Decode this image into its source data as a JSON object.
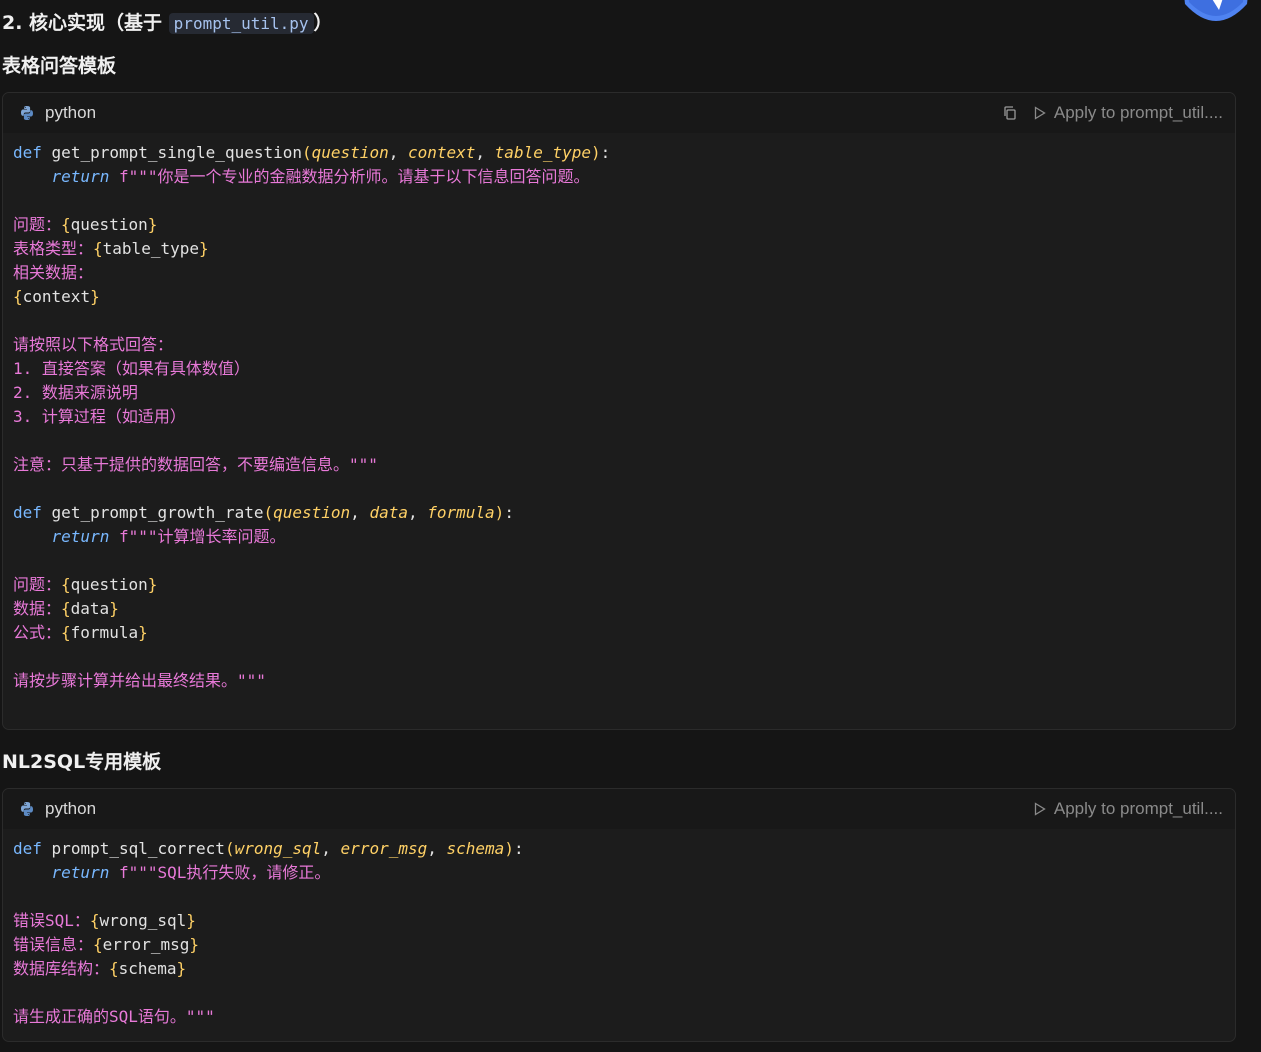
{
  "section": {
    "prefix": "2. 核心实现（基于 ",
    "file": "prompt_util.py",
    "suffix": "）"
  },
  "templates_heading": "表格问答模板",
  "nl2sql_heading": "NL2SQL专用模板",
  "block1": {
    "lang": "python",
    "apply": "Apply to prompt_util....",
    "code": {
      "l1_def": "def",
      "l1_fn": "get_prompt_single_question",
      "l1_p1": "question",
      "l1_p2": "context",
      "l1_p3": "table_type",
      "l2_return": "return",
      "l2_str": "f\"\"\"你是一个专业的金融数据分析师。请基于以下信息回答问题。",
      "l4_label": "问题：",
      "l4_var": "question",
      "l5_label": "表格类型：",
      "l5_var": "table_type",
      "l6_label": "相关数据：",
      "l7_var": "context",
      "l9": "请按照以下格式回答：",
      "l10": "1. 直接答案（如果有具体数值）",
      "l11": "2. 数据来源说明",
      "l12": "3. 计算过程（如适用）",
      "l14": "注意：只基于提供的数据回答，不要编造信息。\"\"\"",
      "l16_def": "def",
      "l16_fn": "get_prompt_growth_rate",
      "l16_p1": "question",
      "l16_p2": "data",
      "l16_p3": "formula",
      "l17_return": "return",
      "l17_str": "f\"\"\"计算增长率问题。",
      "l19_label": "问题：",
      "l19_var": "question",
      "l20_label": "数据：",
      "l20_var": "data",
      "l21_label": "公式：",
      "l21_var": "formula",
      "l23": "请按步骤计算并给出最终结果。\"\"\""
    }
  },
  "block2": {
    "lang": "python",
    "apply": "Apply to prompt_util....",
    "code": {
      "l1_def": "def",
      "l1_fn": "prompt_sql_correct",
      "l1_p1": "wrong_sql",
      "l1_p2": "error_msg",
      "l1_p3": "schema",
      "l2_return": "return",
      "l2_str": "f\"\"\"SQL执行失败，请修正。",
      "l4_label": "错误SQL：",
      "l4_var": "wrong_sql",
      "l5_label": "错误信息：",
      "l5_var": "error_msg",
      "l6_label": "数据库结构：",
      "l6_var": "schema",
      "l8": "请生成正确的SQL语句。\"\"\""
    }
  },
  "colors": {
    "keyword": "#79b8ff",
    "param": "#ffd166",
    "string": "#e879d8",
    "inline_code": "#a6c2ee"
  },
  "icons": {
    "lang": "python-icon",
    "copy": "copy-icon",
    "apply": "play-icon",
    "corner": "app-logo-icon"
  }
}
